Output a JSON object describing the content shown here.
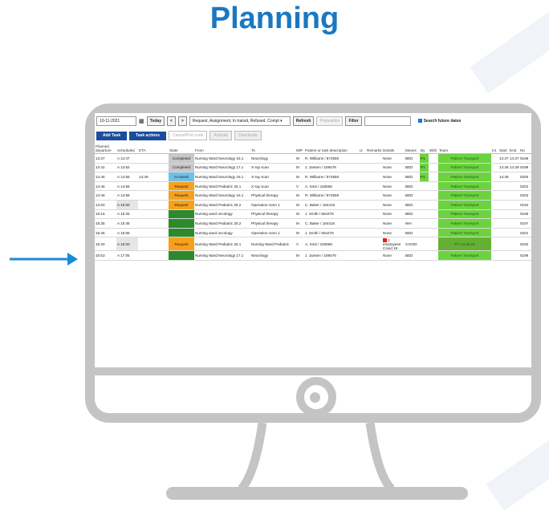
{
  "page": {
    "title": "Planning"
  },
  "toolbar": {
    "date": "10-11-2021",
    "today_label": "Today",
    "prev_label": "<",
    "next_label": ">",
    "state_filter": "Request, Assignment, In transit, Refused, Compl",
    "refresh_label": "Refresh",
    "proposition_label": "Proposition",
    "filter_label": "Filter",
    "filter_value": "",
    "search_future_label": "Search future dates"
  },
  "actions": {
    "add_task_label": "Add Task",
    "task_actions_label": "Task actions",
    "cancel_label": "Cancel/Port code",
    "activate_label": "Activate",
    "deactivate_label": "Deactivate"
  },
  "columns": [
    "Planned departure",
    "Scheduled",
    "ETA",
    "",
    "State",
    "From",
    "To",
    "M/P",
    "Patient or task description",
    "IJ",
    "Remarks",
    "Details",
    "Means",
    "By",
    "With",
    "Team",
    "Int",
    "Start",
    "End",
    "No",
    "Pr",
    "Sp"
  ],
  "rows": [
    {
      "planned": "14:37",
      "sched": "A 14:47",
      "eta": "",
      "extra": "",
      "state": "Completed",
      "state_class": "completed",
      "from": "Nursing Ward Neurology 16.1",
      "to": "Neurology",
      "mp": "M",
      "patient": "R. Williams / 874550",
      "details": "None",
      "means": "BED",
      "by": "P1",
      "team": "Patient Transport",
      "start": "14:37",
      "end": "14:37",
      "no": "0195",
      "pr": "6",
      "sp": "0"
    },
    {
      "planned": "14:42",
      "sched": "A 14:52",
      "eta": "",
      "extra": "",
      "state": "Completed",
      "state_class": "completed",
      "from": "Nursing Ward Neurology 17.1",
      "to": "X-ray scan",
      "mp": "M",
      "patient": "J. Jansen / 189476",
      "details": "None",
      "means": "BED",
      "by": "P1",
      "team": "Patient Transport",
      "start": "14:38",
      "end": "14:39",
      "no": "0199",
      "pr": "6",
      "sp": "0"
    },
    {
      "planned": "14:45",
      "sched": "A 14:55",
      "eta": "14:49",
      "extra": "",
      "state": "In transit",
      "state_class": "transit",
      "from": "Nursing Ward Neurology 16.1",
      "to": "X-ray scan",
      "mp": "M",
      "patient": "R. Williams / 874550",
      "details": "None",
      "means": "BED",
      "by": "P1",
      "team": "Patient Transport",
      "start": "14:39",
      "end": "",
      "no": "0200",
      "pr": "6",
      "sp": "0"
    },
    {
      "planned": "14:45",
      "sched": "A 14:55",
      "eta": "",
      "extra": "",
      "state": "Request",
      "state_class": "request",
      "from": "Nursing Ward Pediatric 25.1",
      "to": "X-ray scan",
      "mp": "V",
      "patient": "A. Smit / 183556",
      "details": "None",
      "means": "BED",
      "by": "",
      "team": "Patient Transport",
      "start": "",
      "end": "",
      "no": "0202",
      "pr": "6",
      "sp": "0"
    },
    {
      "planned": "14:46",
      "sched": "A 14:56",
      "eta": "",
      "extra": "",
      "state": "Request",
      "state_class": "request",
      "from": "Nursing Ward Neurology 16.1",
      "to": "Physical therapy",
      "mp": "M",
      "patient": "R. Williams / 874550",
      "details": "None",
      "means": "BED",
      "by": "",
      "team": "Patient Transport",
      "start": "",
      "end": "",
      "no": "0203",
      "pr": "6",
      "sp": "0"
    },
    {
      "planned": "14:50",
      "sched": "A 15:00",
      "eta": "",
      "extra": "",
      "state": "Request",
      "state_class": "request",
      "from": "Nursing Ward Pediatric 25.2",
      "to": "Operation room 1",
      "mp": "M",
      "patient": "C. Baker / 184416",
      "details": "None",
      "means": "BED",
      "by": "",
      "team": "Patient Transport",
      "start": "",
      "end": "",
      "no": "0194",
      "pr": "6",
      "sp": "0"
    },
    {
      "planned": "15:15",
      "sched": "A 15:25",
      "eta": "",
      "extra": "",
      "state": "Request",
      "state_class": "green",
      "from": "Nursing ward oncology",
      "to": "Physical therapy",
      "mp": "M",
      "patient": "J. Smith / 584476",
      "details": "None",
      "means": "BED",
      "by": "",
      "team": "Patient Transport",
      "start": "",
      "end": "",
      "no": "0196",
      "pr": "6",
      "sp": "0"
    },
    {
      "planned": "15:35",
      "sched": "A 15:45",
      "eta": "",
      "extra": "",
      "state": "Request",
      "state_class": "green",
      "from": "Nursing Ward Pediatric 25.2",
      "to": "Physical therapy",
      "mp": "M",
      "patient": "C. Baker / 184416",
      "details": "None",
      "means": "WH",
      "by": "",
      "team": "Patient Transport",
      "start": "",
      "end": "",
      "no": "0197",
      "pr": "6",
      "sp": "0"
    },
    {
      "planned": "15:45",
      "sched": "A 15:55",
      "eta": "",
      "extra": "",
      "state": "Request",
      "state_class": "green",
      "from": "Nursing ward oncology",
      "to": "Operation room 1",
      "mp": "M",
      "patient": "J. Smith / 584476",
      "details": "None",
      "means": "BED",
      "by": "",
      "team": "Patient Transport",
      "start": "",
      "end": "",
      "no": "0201",
      "pr": "6",
      "sp": "0"
    },
    {
      "planned": "15:40",
      "sched": "A 16:00",
      "eta": "",
      "extra": "",
      "state": "Request",
      "state_class": "request",
      "from": "Nursing Ward Pediatric 25.1",
      "to": "Nursing Ward Pediatric",
      "mp": "V",
      "patient": "A. Smit / 183556",
      "details": "2 employees Covid 19",
      "means": "COVID",
      "by": "",
      "team": "PT Covid 19",
      "start": "",
      "end": "",
      "no": "0192",
      "pr": "6",
      "sp": "0"
    },
    {
      "planned": "16:53",
      "sched": "A 17:05",
      "eta": "",
      "extra": "",
      "state": "Request",
      "state_class": "green",
      "from": "Nursing Ward Neurology 17.1",
      "to": "Neurology",
      "mp": "M",
      "patient": "J. Jansen / 189476",
      "details": "None",
      "means": "BED",
      "by": "",
      "team": "Patient Transport",
      "start": "",
      "end": "",
      "no": "0198",
      "pr": "6",
      "sp": "0"
    }
  ],
  "colors": {
    "accent": "#1a78c2",
    "arrow": "#1a8ad4",
    "monitor": "#c4c4c4",
    "team": "#6cd33f",
    "request": "#f7a11a",
    "transit": "#6ec0e8",
    "done": "#c8c8c8",
    "dark_green": "#2c8a2c"
  }
}
